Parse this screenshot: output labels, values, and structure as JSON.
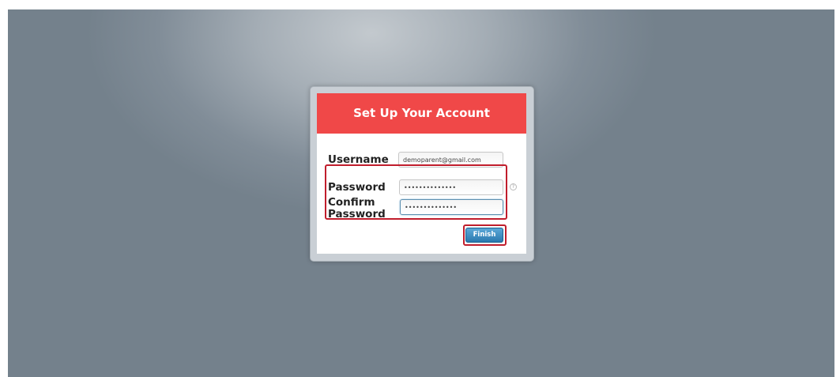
{
  "setup_form": {
    "title": "Set Up Your Account",
    "username": {
      "label": "Username",
      "value": "demoparent@gmail.com"
    },
    "password": {
      "label": "Password",
      "value": "••••••••••••••",
      "help_icon": "help-icon"
    },
    "confirm_password": {
      "label_line1": "Confirm",
      "label_line2": "Password",
      "value": "••••••••••••••"
    },
    "finish_label": "Finish"
  },
  "colors": {
    "header": "#f04848",
    "highlight": "#c01d2c",
    "button": "#2b79ae",
    "background": "#74818c"
  }
}
